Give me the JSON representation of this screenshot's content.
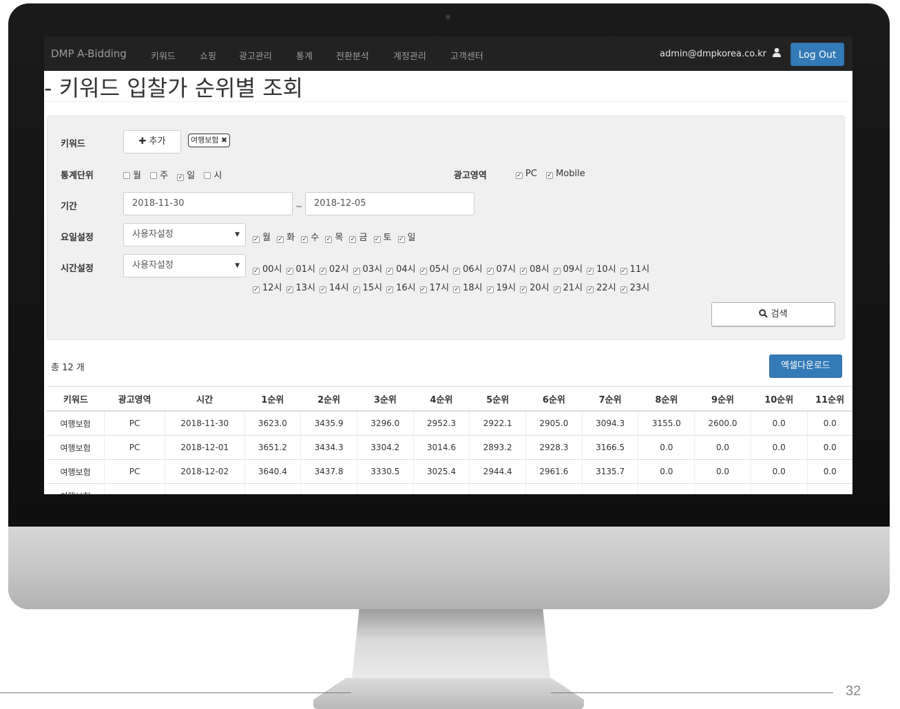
{
  "navbar": {
    "brand": "DMP A-Bidding",
    "items": [
      "키워드",
      "쇼핑",
      "광고관리",
      "통계",
      "전환분석",
      "계정관리",
      "고객센터"
    ],
    "user_email": "admin@dmpkorea.co.kr",
    "logout_label": "Log Out"
  },
  "page_title": "- 키워드 입찰가 순위별 조회",
  "filters": {
    "keyword_label": "키워드",
    "add_button": "✚ 추가",
    "keyword_tag": "여행보험 ✖",
    "stat_unit_label": "통계단위",
    "stat_units": [
      {
        "label": "월",
        "checked": false
      },
      {
        "label": "주",
        "checked": false
      },
      {
        "label": "일",
        "checked": true
      },
      {
        "label": "시",
        "checked": false
      }
    ],
    "ad_area_label": "광고영역",
    "ad_areas": [
      {
        "label": "PC",
        "checked": true
      },
      {
        "label": "Mobile",
        "checked": true
      }
    ],
    "period_label": "기간",
    "date_from": "2018-11-30",
    "date_separator": "~",
    "date_to": "2018-12-05",
    "weekday_label": "요일설정",
    "weekday_select": "사용자설정",
    "weekdays": [
      "월",
      "화",
      "수",
      "목",
      "금",
      "토",
      "일"
    ],
    "time_label": "시간설정",
    "time_select": "사용자설정",
    "hours_row1": [
      "00시",
      "01시",
      "02시",
      "03시",
      "04시",
      "05시",
      "06시",
      "07시",
      "08시",
      "09시",
      "10시",
      "11시"
    ],
    "hours_row2": [
      "12시",
      "13시",
      "14시",
      "15시",
      "16시",
      "17시",
      "18시",
      "19시",
      "20시",
      "21시",
      "22시",
      "23시"
    ],
    "search_button": "검색"
  },
  "results": {
    "total": "총 12 개",
    "excel_button": "엑셀다운로드",
    "headers": [
      "키워드",
      "광고영역",
      "시간",
      "1순위",
      "2순위",
      "3순위",
      "4순위",
      "5순위",
      "6순위",
      "7순위",
      "8순위",
      "9순위",
      "10순위",
      "11순위"
    ],
    "rows": [
      [
        "여행보험",
        "PC",
        "2018-11-30",
        "3623.0",
        "3435.9",
        "3296.0",
        "2952.3",
        "2922.1",
        "2905.0",
        "3094.3",
        "3155.0",
        "2600.0",
        "0.0",
        "0.0"
      ],
      [
        "여행보험",
        "PC",
        "2018-12-01",
        "3651.2",
        "3434.3",
        "3304.2",
        "3014.6",
        "2893.2",
        "2928.3",
        "3166.5",
        "0.0",
        "0.0",
        "0.0",
        "0.0"
      ],
      [
        "여행보험",
        "PC",
        "2018-12-02",
        "3640.4",
        "3437.8",
        "3330.5",
        "3025.4",
        "2944.4",
        "2961.6",
        "3135.7",
        "0.0",
        "0.0",
        "0.0",
        "0.0"
      ],
      [
        "여행보험",
        "",
        "",
        "",
        "",
        "",
        "",
        "",
        "",
        "",
        "",
        "",
        "",
        ""
      ]
    ]
  },
  "slide": {
    "page_number": "32"
  }
}
